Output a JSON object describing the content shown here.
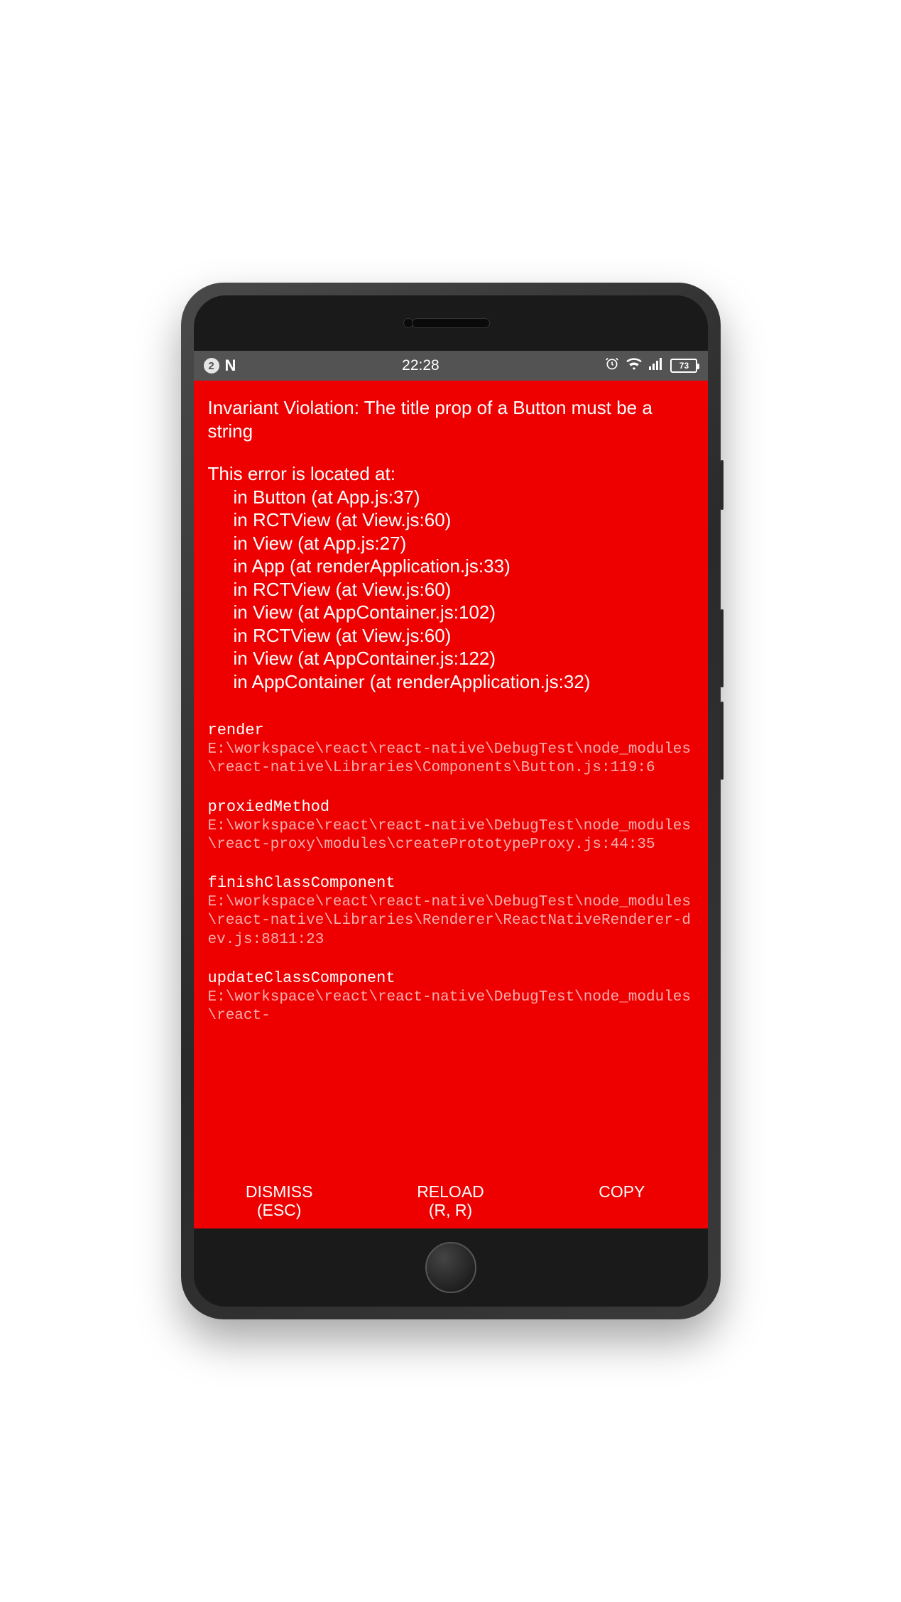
{
  "status_bar": {
    "notif_count": "2",
    "n_label": "N",
    "time": "22:28",
    "battery": "73"
  },
  "error": {
    "title": "Invariant Violation: The title prop of a Button must be a string",
    "location_header": "This error is located at:",
    "component_stack": [
      "in Button (at App.js:37)",
      "in RCTView (at View.js:60)",
      "in View (at App.js:27)",
      "in App (at renderApplication.js:33)",
      "in RCTView (at View.js:60)",
      "in View (at AppContainer.js:102)",
      "in RCTView (at View.js:60)",
      "in View (at AppContainer.js:122)",
      "in AppContainer (at renderApplication.js:32)"
    ],
    "frames": [
      {
        "fn": "render",
        "path": "E:\\workspace\\react\\react-native\\DebugTest\\node_modules\\react-native\\Libraries\\Components\\Button.js:119:6"
      },
      {
        "fn": "proxiedMethod",
        "path": "E:\\workspace\\react\\react-native\\DebugTest\\node_modules\\react-proxy\\modules\\createPrototypeProxy.js:44:35"
      },
      {
        "fn": "finishClassComponent",
        "path": "E:\\workspace\\react\\react-native\\DebugTest\\node_modules\\react-native\\Libraries\\Renderer\\ReactNativeRenderer-dev.js:8811:23"
      },
      {
        "fn": "updateClassComponent",
        "path": "E:\\workspace\\react\\react-native\\DebugTest\\node_modules\\react-"
      }
    ]
  },
  "footer": {
    "dismiss_line1": "DISMISS",
    "dismiss_line2": "(ESC)",
    "reload_line1": "RELOAD",
    "reload_line2": "(R, R)",
    "copy": "COPY"
  }
}
